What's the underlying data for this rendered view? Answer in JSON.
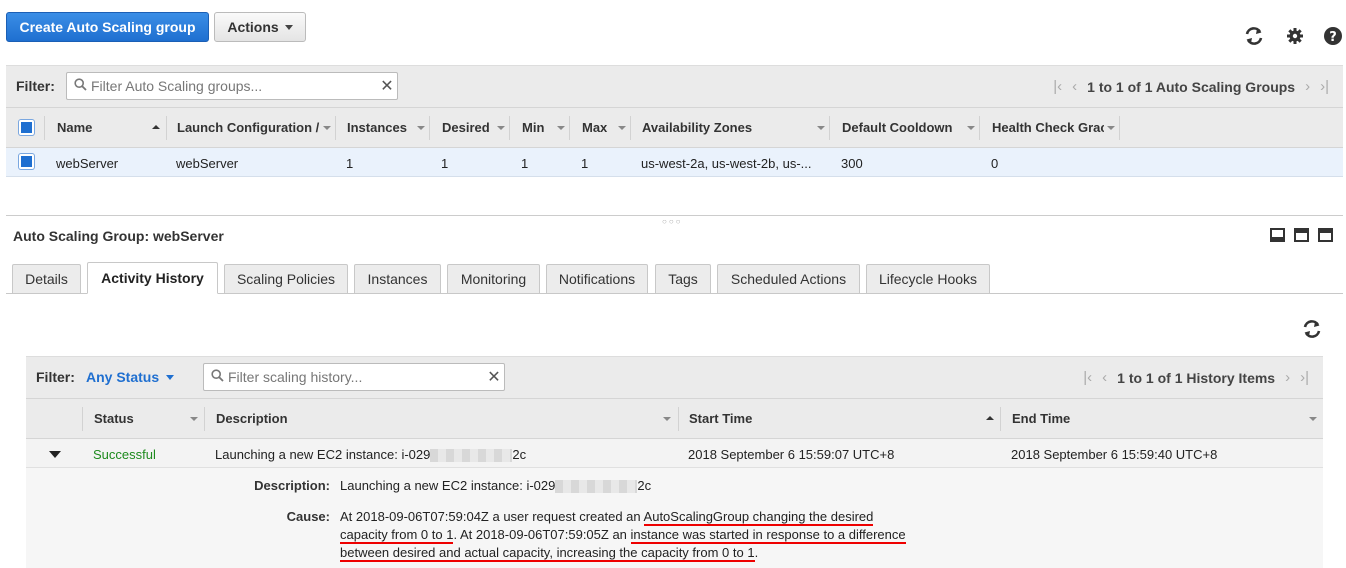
{
  "toolbar": {
    "create_label": "Create Auto Scaling group",
    "actions_label": "Actions",
    "refresh_icon": "refresh-icon",
    "settings_icon": "gear-icon",
    "help_icon": "help-icon"
  },
  "asg_filter": {
    "label": "Filter:",
    "placeholder": "Filter Auto Scaling groups...",
    "pager_text": "1 to 1 of 1 Auto Scaling Groups"
  },
  "asg_table": {
    "columns": [
      "Name",
      "Launch Configuration /",
      "Instances",
      "Desired",
      "Min",
      "Max",
      "Availability Zones",
      "Default Cooldown",
      "Health Check Grac"
    ],
    "rows": [
      {
        "name": "webServer",
        "launch_config": "webServer",
        "instances": "1",
        "desired": "1",
        "min": "1",
        "max": "1",
        "zones": "us-west-2a, us-west-2b, us-...",
        "cooldown": "300",
        "health_grace": "0"
      }
    ]
  },
  "detail": {
    "title": "Auto Scaling Group: webServer",
    "tabs": [
      "Details",
      "Activity History",
      "Scaling Policies",
      "Instances",
      "Monitoring",
      "Notifications",
      "Tags",
      "Scheduled Actions",
      "Lifecycle Hooks"
    ],
    "active_tab": "Activity History"
  },
  "history_filter": {
    "label": "Filter:",
    "status": "Any Status",
    "placeholder": "Filter scaling history...",
    "pager_text": "1 to 1 of 1 History Items"
  },
  "history_table": {
    "columns": [
      "Status",
      "Description",
      "Start Time",
      "End Time"
    ],
    "rows": [
      {
        "status": "Successful",
        "description_prefix": "Launching a new EC2 instance: i-029",
        "description_suffix": "2c",
        "start_time": "2018 September 6 15:59:07 UTC+8",
        "end_time": "2018 September 6 15:59:40 UTC+8"
      }
    ]
  },
  "history_detail": {
    "description_label": "Description:",
    "description_prefix": "Launching a new EC2 instance: i-029",
    "description_suffix": "2c",
    "cause_label": "Cause:",
    "cause_line1_a": "At 2018-09-06T07:59:04Z a user request created an ",
    "cause_line1_b": "AutoScalingGroup changing the desired",
    "cause_line2_a": "capacity from 0 to 1",
    "cause_line2_b": ". At 2018-09-06T07:59:05Z an ",
    "cause_line2_c": "instance was started in response to a difference",
    "cause_line3_a": "between desired and actual capacity, increasing the capacity from 0 to 1",
    "cause_line3_b": "."
  },
  "colors": {
    "primary": "#1f6fd0",
    "success": "#1d8a1d",
    "annotation": "#e00000"
  }
}
